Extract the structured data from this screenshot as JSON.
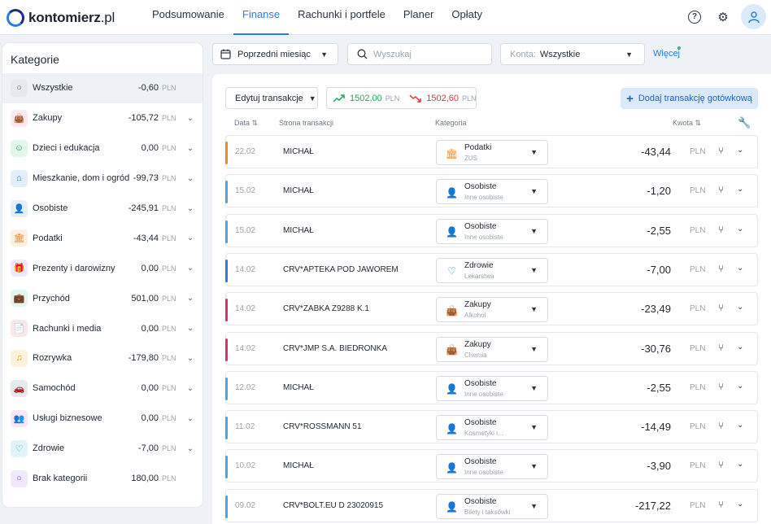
{
  "brand": {
    "name_bold": "kontomierz",
    "name_light": ".pl"
  },
  "nav": [
    {
      "label": "Podsumowanie",
      "active": false
    },
    {
      "label": "Finanse",
      "active": true
    },
    {
      "label": "Rachunki i portfele",
      "active": false
    },
    {
      "label": "Planer",
      "active": false
    },
    {
      "label": "Opłaty",
      "active": false
    }
  ],
  "top_icons": {
    "help": "?",
    "settings": "⚙"
  },
  "sidebar": {
    "title": "Kategorie",
    "currency": "PLN",
    "items": [
      {
        "name": "Wszystkie",
        "amount": "-0,60",
        "icon": "circle-icon",
        "glyph": "○",
        "color": "#5b6470",
        "bg": "#e6e9ee",
        "active": true,
        "expandable": false
      },
      {
        "name": "Zakupy",
        "amount": "-105,72",
        "icon": "shopping-bag-icon",
        "glyph": "👜",
        "color": "#e0489a",
        "bg": "#fde8f3",
        "active": false,
        "expandable": true
      },
      {
        "name": "Dzieci i edukacja",
        "amount": "0,00",
        "icon": "smile-icon",
        "glyph": "☺",
        "color": "#22a55b",
        "bg": "#e3f6ec",
        "active": false,
        "expandable": true
      },
      {
        "name": "Mieszkanie, dom i ogród",
        "amount": "-99,73",
        "icon": "house-icon",
        "glyph": "⌂",
        "color": "#2a7de1",
        "bg": "#e3eefb",
        "active": false,
        "expandable": true
      },
      {
        "name": "Osobiste",
        "amount": "-245,91",
        "icon": "person-icon",
        "glyph": "👤",
        "color": "#2a9bd6",
        "bg": "#e3f2fa",
        "active": false,
        "expandable": true
      },
      {
        "name": "Podatki",
        "amount": "-43,44",
        "icon": "bank-icon",
        "glyph": "🏛",
        "color": "#f08a24",
        "bg": "#fdf0e3",
        "active": false,
        "expandable": true
      },
      {
        "name": "Prezenty i darowizny",
        "amount": "0,00",
        "icon": "gift-icon",
        "glyph": "🎁",
        "color": "#8a4fe0",
        "bg": "#f0e8fc",
        "active": false,
        "expandable": true
      },
      {
        "name": "Przychód",
        "amount": "501,00",
        "icon": "briefcase-icon",
        "glyph": "💼",
        "color": "#22a55b",
        "bg": "#e3f6ec",
        "active": false,
        "expandable": true
      },
      {
        "name": "Rachunki i media",
        "amount": "0,00",
        "icon": "document-icon",
        "glyph": "📄",
        "color": "#e0383e",
        "bg": "#fce6e7",
        "active": false,
        "expandable": true
      },
      {
        "name": "Rozrywka",
        "amount": "-179,80",
        "icon": "music-icon",
        "glyph": "♫",
        "color": "#e0a10f",
        "bg": "#fcf3dc",
        "active": false,
        "expandable": true
      },
      {
        "name": "Samochód",
        "amount": "0,00",
        "icon": "car-icon",
        "glyph": "🚗",
        "color": "#3a4350",
        "bg": "#e6e9ee",
        "active": false,
        "expandable": true
      },
      {
        "name": "Usługi biznesowe",
        "amount": "0,00",
        "icon": "people-icon",
        "glyph": "👥",
        "color": "#d43fc9",
        "bg": "#fbe5f8",
        "active": false,
        "expandable": true
      },
      {
        "name": "Zdrowie",
        "amount": "-7,00",
        "icon": "heart-icon",
        "glyph": "♡",
        "color": "#1aa6c4",
        "bg": "#e0f4f8",
        "active": false,
        "expandable": true
      },
      {
        "name": "Brak kategorii",
        "amount": "180,00",
        "icon": "circle-icon",
        "glyph": "○",
        "color": "#8a4fe0",
        "bg": "#f0e8fc",
        "active": false,
        "expandable": false
      }
    ]
  },
  "filters": {
    "period": "Poprzedni miesiąc",
    "search_placeholder": "Wyszukaj",
    "accounts_label": "Konta:",
    "accounts_value": "Wszystkie",
    "more": "Więcej"
  },
  "toolbar": {
    "edit_label": "Edytuj transakcje",
    "income": "1502,00",
    "expense": "1502,60",
    "currency": "PLN",
    "add_label": "Dodaj transakcję gotówkową"
  },
  "table": {
    "headers": {
      "date": "Data",
      "party": "Strona transakcji",
      "category": "Kategoria",
      "amount": "Kwota"
    },
    "currency": "PLN",
    "rows": [
      {
        "date": "22.02",
        "party": "MICHAŁ",
        "category": "Podatki",
        "subcategory": "ZUS",
        "amount": "-43,44",
        "bar": "#f08a24",
        "icon": "bank-icon",
        "glyph": "🏛",
        "color": "#f08a24"
      },
      {
        "date": "15.02",
        "party": "MICHAŁ",
        "category": "Osobiste",
        "subcategory": "Inne osobiste",
        "amount": "-1,20",
        "bar": "#4aa3e8",
        "icon": "person-question-icon",
        "glyph": "👤",
        "color": "#2a9bd6"
      },
      {
        "date": "15.02",
        "party": "MICHAŁ",
        "category": "Osobiste",
        "subcategory": "Inne osobiste",
        "amount": "-2,55",
        "bar": "#4aa3e8",
        "icon": "person-question-icon",
        "glyph": "👤",
        "color": "#2a9bd6"
      },
      {
        "date": "14.02",
        "party": "CRV*APTEKA POD JAWOREM",
        "category": "Zdrowie",
        "subcategory": "Lekarstwa",
        "amount": "-7,00",
        "bar": "#2a7de1",
        "icon": "heart-icon",
        "glyph": "♡",
        "color": "#1aa6c4"
      },
      {
        "date": "14.02",
        "party": "CRV*ZABKA Z9288 K.1",
        "category": "Zakupy",
        "subcategory": "Alkohol",
        "amount": "-23,49",
        "bar": "#d6336c",
        "icon": "shopping-bag-icon",
        "glyph": "👜",
        "color": "#e0489a"
      },
      {
        "date": "14.02",
        "party": "CRV*JMP S.A. BIEDRONKA",
        "category": "Zakupy",
        "subcategory": "Chemia",
        "amount": "-30,76",
        "bar": "#d6336c",
        "icon": "shopping-bag-icon",
        "glyph": "👜",
        "color": "#e0489a"
      },
      {
        "date": "12.02",
        "party": "MICHAŁ",
        "category": "Osobiste",
        "subcategory": "Inne osobiste",
        "amount": "-2,55",
        "bar": "#4aa3e8",
        "icon": "person-question-icon",
        "glyph": "👤",
        "color": "#2a9bd6"
      },
      {
        "date": "11.02",
        "party": "CRV*ROSSMANN 51",
        "category": "Osobiste",
        "subcategory": "Kosmetyki i…",
        "amount": "-14,49",
        "bar": "#4aa3e8",
        "icon": "person-question-icon",
        "glyph": "👤",
        "color": "#2a9bd6"
      },
      {
        "date": "10.02",
        "party": "MICHAŁ",
        "category": "Osobiste",
        "subcategory": "Inne osobiste",
        "amount": "-3,90",
        "bar": "#4aa3e8",
        "icon": "person-question-icon",
        "glyph": "👤",
        "color": "#2a9bd6"
      },
      {
        "date": "09.02",
        "party": "CRV*BOLT.EU D 23020915",
        "category": "Osobiste",
        "subcategory": "Bilety i taksówki",
        "amount": "-217,22",
        "bar": "#4aa3e8",
        "icon": "person-question-icon",
        "glyph": "👤",
        "color": "#2a9bd6"
      }
    ]
  }
}
